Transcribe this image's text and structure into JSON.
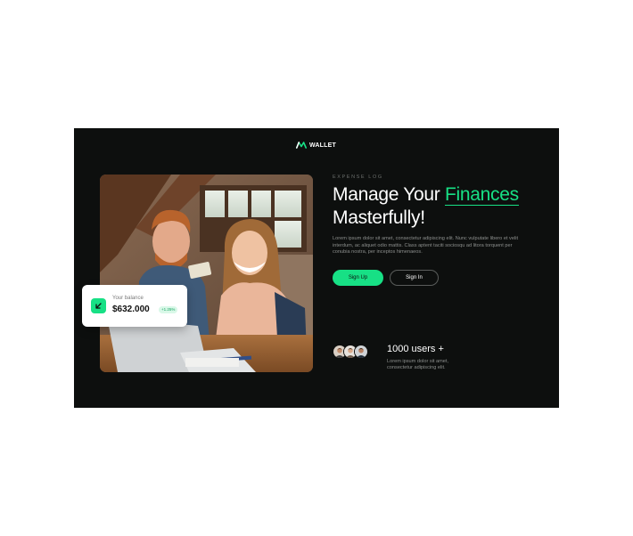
{
  "brand": {
    "name": "WALLET",
    "logo_icon": "wallet-logo-icon",
    "accent_color": "#17e085"
  },
  "hero": {
    "eyebrow": "EXPENSE LOG",
    "headline_part1": "Manage Your ",
    "headline_accent": "Finances",
    "headline_part2": "Masterfully!",
    "description": "Lorem ipsum dolor sit amet, consectetur adipiscing elit. Nunc vulputate libero et velit interdum, ac aliquet odio mattis. Class aptent taciti sociosqu ad litora torquent per conubia nostra, per inceptos himenaeos."
  },
  "buttons": {
    "signup": "Sign Up",
    "signin": "Sign In"
  },
  "balance_card": {
    "label": "Your balance",
    "value": "$632.000",
    "badge": "+1.25%",
    "icon": "arrow-down-left-icon"
  },
  "users": {
    "count": "1000 users +",
    "subtitle": "Lorem ipsum dolor sit amet, consectetur adipiscing elit."
  }
}
